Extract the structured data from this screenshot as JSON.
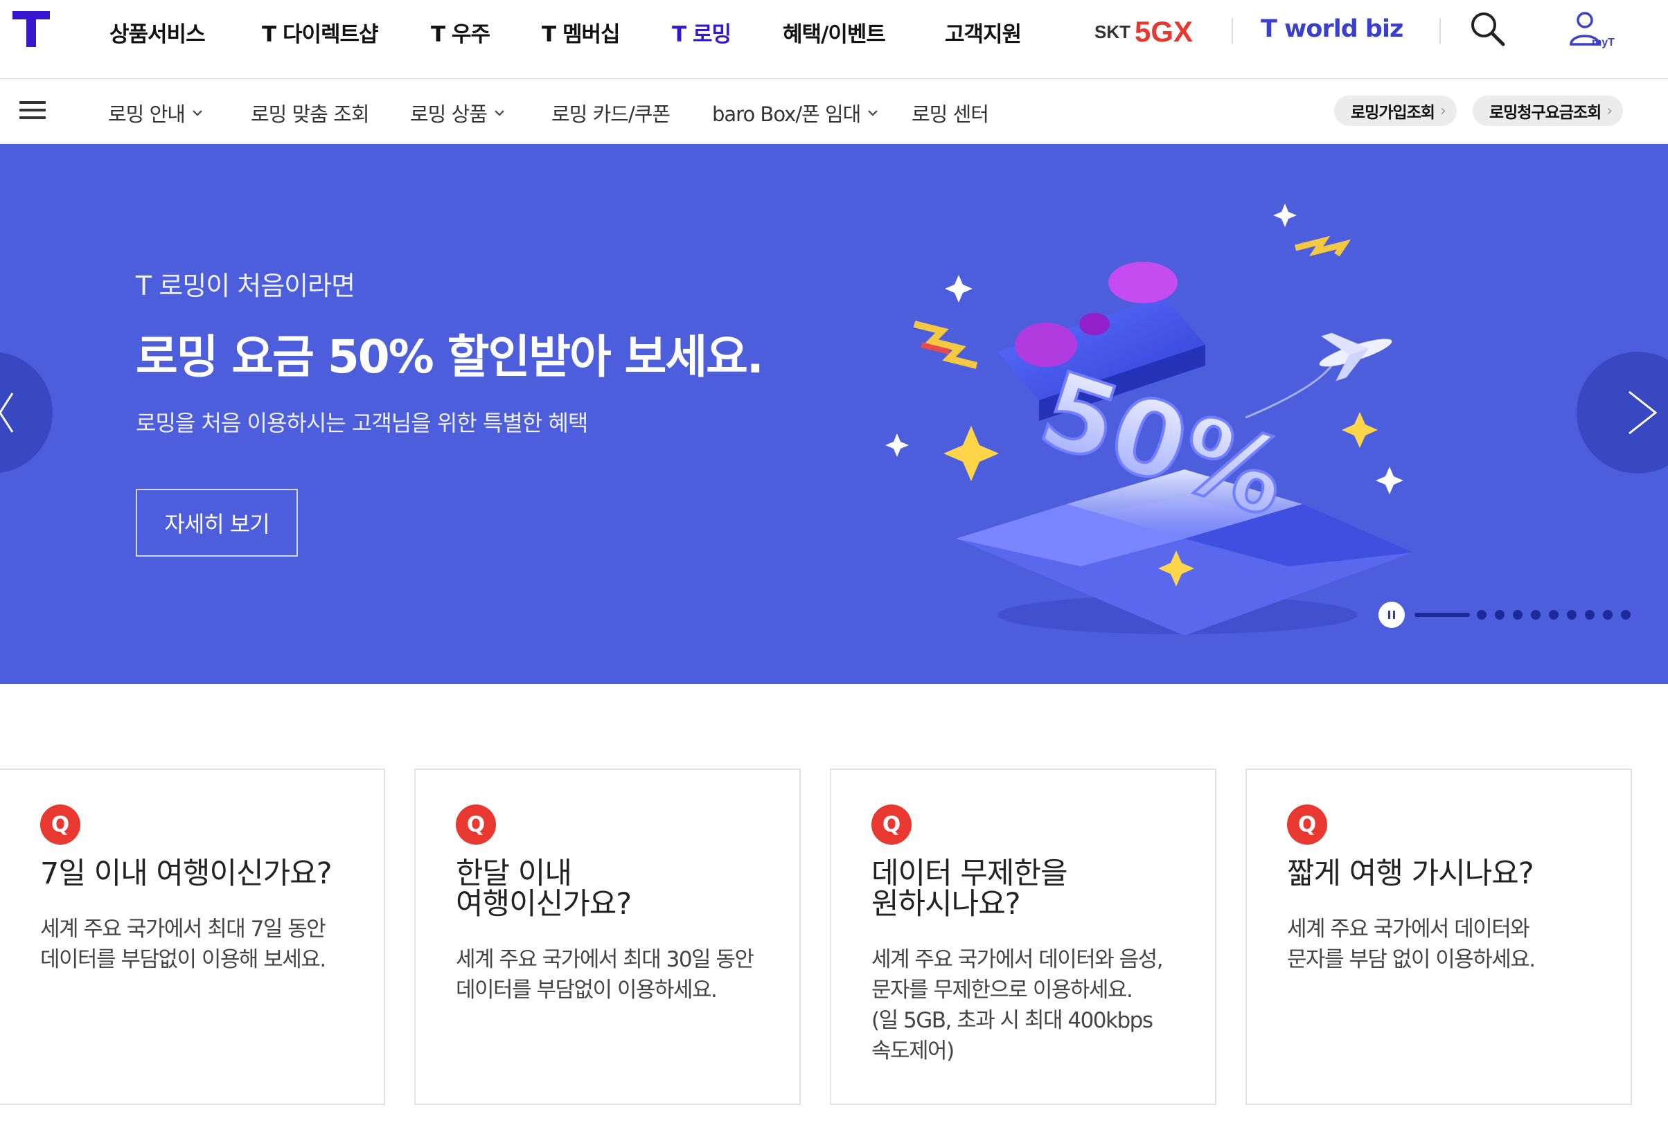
{
  "gnb": {
    "logo_icon": "t-logo-icon",
    "items": [
      {
        "label": "상품서비스",
        "active": false
      },
      {
        "label": "T 다이렉트샵",
        "active": false
      },
      {
        "label": "T 우주",
        "active": false
      },
      {
        "label": "T 멤버십",
        "active": false
      },
      {
        "label": "T 로밍",
        "active": true
      },
      {
        "label": "혜택/이벤트",
        "active": false
      },
      {
        "label": "고객지원",
        "active": false
      }
    ],
    "skt_text": "SKT",
    "fivegx_text": "5GX",
    "tworldbiz_label": "T world biz",
    "search_icon": "search-icon",
    "myt_label": "myT",
    "active_color": "#3617ce"
  },
  "lnb": {
    "menu_icon": "hamburger-menu-icon",
    "items": [
      {
        "label": "로밍 안내",
        "has_dropdown": true
      },
      {
        "label": "로밍 맞춤 조회",
        "has_dropdown": false
      },
      {
        "label": "로밍 상품",
        "has_dropdown": true
      },
      {
        "label": "로밍 카드/쿠폰",
        "has_dropdown": false
      },
      {
        "label": "baro Box/폰 임대",
        "has_dropdown": true
      },
      {
        "label": "로밍 센터",
        "has_dropdown": false
      }
    ],
    "quick_links": [
      {
        "label": "로밍가입조회"
      },
      {
        "label": "로밍청구요금조회"
      }
    ]
  },
  "hero": {
    "background_color": "#4c5edb",
    "subtitle": "T 로밍이 처음이라면",
    "title": "로밍 요금 50% 할인받아 보세요.",
    "description": "로밍을 처음 이용하시는 고객님을 위한 특별한 혜택",
    "cta_label": "자세히 보기",
    "art_text": "50%",
    "slide_count": 10,
    "current_slide": 1
  },
  "cards": [
    {
      "badge": "Q",
      "title": "7일 이내 여행이신가요?",
      "description_lines": [
        "세계 주요 국가에서 최대 7일 동안",
        "데이터를 부담없이 이용해 보세요."
      ]
    },
    {
      "badge": "Q",
      "title_lines": [
        "한달 이내",
        "여행이신가요?"
      ],
      "description_lines": [
        "세계 주요 국가에서 최대 30일 동안",
        "데이터를 부담없이 이용하세요."
      ]
    },
    {
      "badge": "Q",
      "title_lines": [
        "데이터 무제한을",
        "원하시나요?"
      ],
      "description_lines": [
        "세계 주요 국가에서 데이터와 음성,",
        "문자를 무제한으로 이용하세요.",
        "(일 5GB, 초과 시 최대 400kbps",
        "속도제어)"
      ]
    },
    {
      "badge": "Q",
      "title": "짧게 여행 가시나요?",
      "description_lines": [
        "세계 주요 국가에서 데이터와",
        "문자를 부담 없이 이용하세요."
      ]
    }
  ],
  "colors": {
    "accent": "#3617ce",
    "q_badge": "#e8382f",
    "hero_bg": "#4c5edb"
  }
}
